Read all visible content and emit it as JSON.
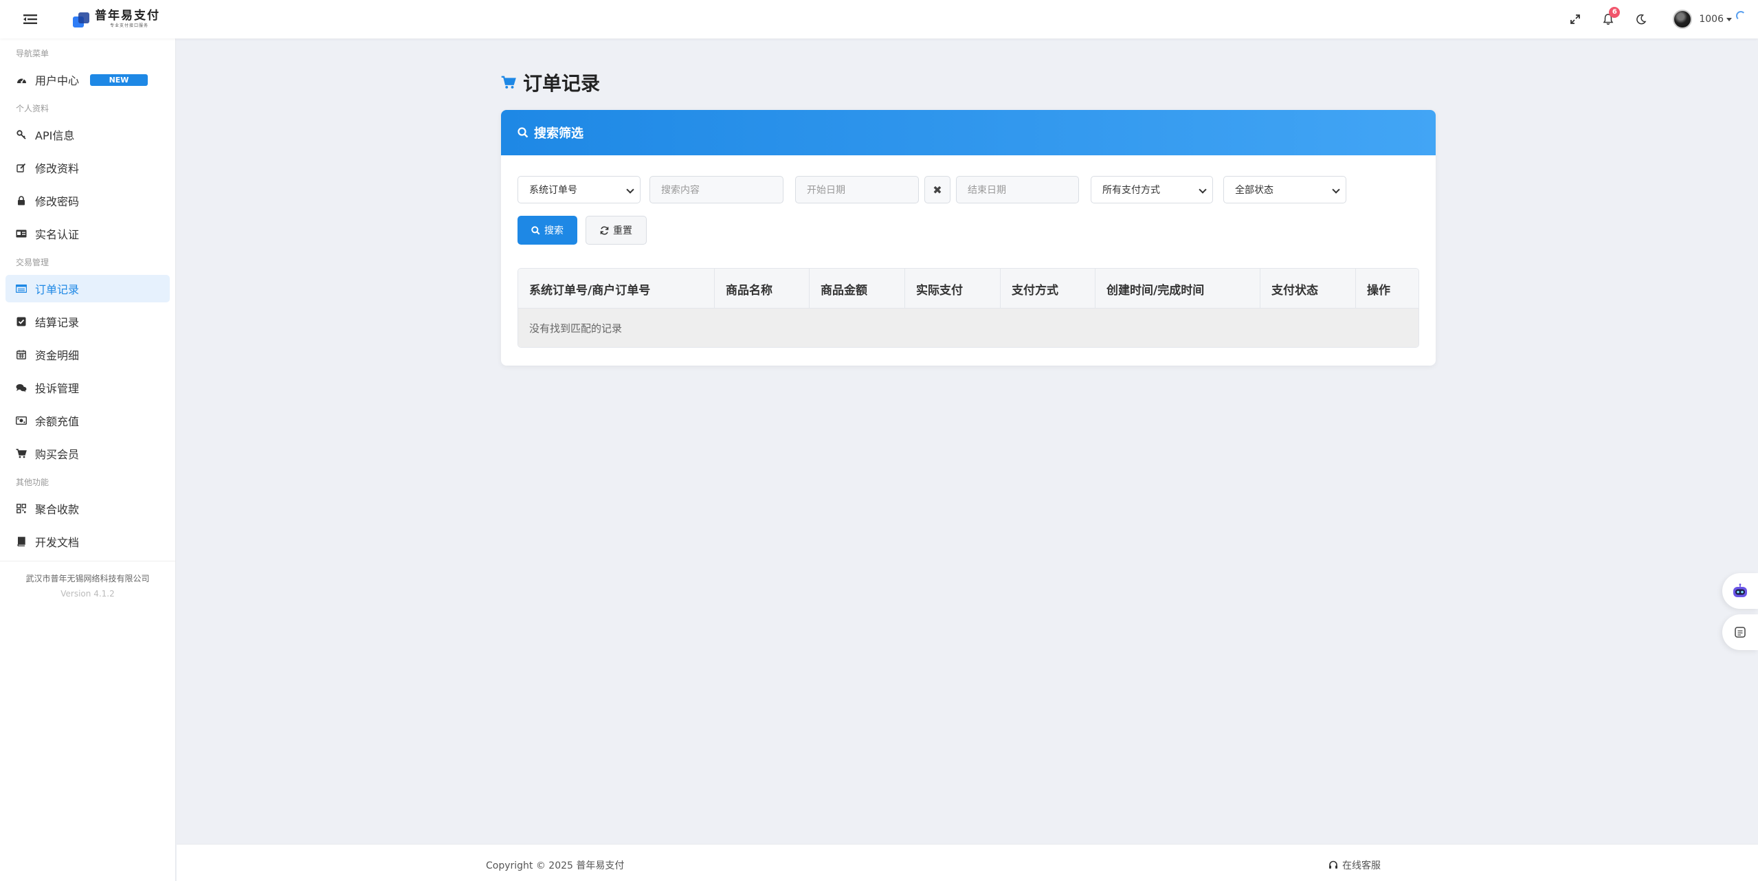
{
  "header": {
    "logo_title": "普年易支付",
    "logo_subtitle": "专业支付接口服务",
    "notification_count": "6",
    "username": "1006"
  },
  "sidebar": {
    "sections": [
      {
        "title": "导航菜单",
        "items": [
          {
            "label": "用户中心",
            "icon": "dashboard-icon",
            "tag": "NEW"
          }
        ]
      },
      {
        "title": "个人资料",
        "items": [
          {
            "label": "API信息",
            "icon": "key-icon"
          },
          {
            "label": "修改资料",
            "icon": "edit-icon"
          },
          {
            "label": "修改密码",
            "icon": "lock-icon"
          },
          {
            "label": "实名认证",
            "icon": "id-card-icon"
          }
        ]
      },
      {
        "title": "交易管理",
        "items": [
          {
            "label": "订单记录",
            "icon": "list-icon",
            "active": true
          },
          {
            "label": "结算记录",
            "icon": "check-square-icon"
          },
          {
            "label": "资金明细",
            "icon": "calendar-icon"
          },
          {
            "label": "投诉管理",
            "icon": "comments-icon"
          },
          {
            "label": "余额充值",
            "icon": "money-icon"
          },
          {
            "label": "购买会员",
            "icon": "cart-icon"
          }
        ]
      },
      {
        "title": "其他功能",
        "items": [
          {
            "label": "聚合收款",
            "icon": "qrcode-icon"
          },
          {
            "label": "开发文档",
            "icon": "book-icon"
          }
        ]
      }
    ],
    "company": "武汉市普年无锡网络科技有限公司",
    "version": "Version 4.1.2"
  },
  "page": {
    "title": "订单记录",
    "icon": "cart-icon",
    "card_title": "搜索筛选",
    "filters": {
      "field_select": "系统订单号",
      "search_placeholder": "搜索内容",
      "start_date_placeholder": "开始日期",
      "clear_symbol": "✖",
      "end_date_placeholder": "结束日期",
      "pay_method_select": "所有支付方式",
      "status_select": "全部状态"
    },
    "buttons": {
      "search": "搜索",
      "reset": "重置"
    },
    "table": {
      "columns": [
        "系统订单号/商户订单号",
        "商品名称",
        "商品金额",
        "实际支付",
        "支付方式",
        "创建时间/完成时间",
        "支付状态",
        "操作"
      ],
      "empty_text": "没有找到匹配的记录"
    }
  },
  "footer": {
    "copyright": "Copyright © 2025 普年易支付",
    "support": "在线客服"
  },
  "colors": {
    "primary": "#1e88e5",
    "badge": "#f1556c",
    "background": "#eef0f5"
  }
}
